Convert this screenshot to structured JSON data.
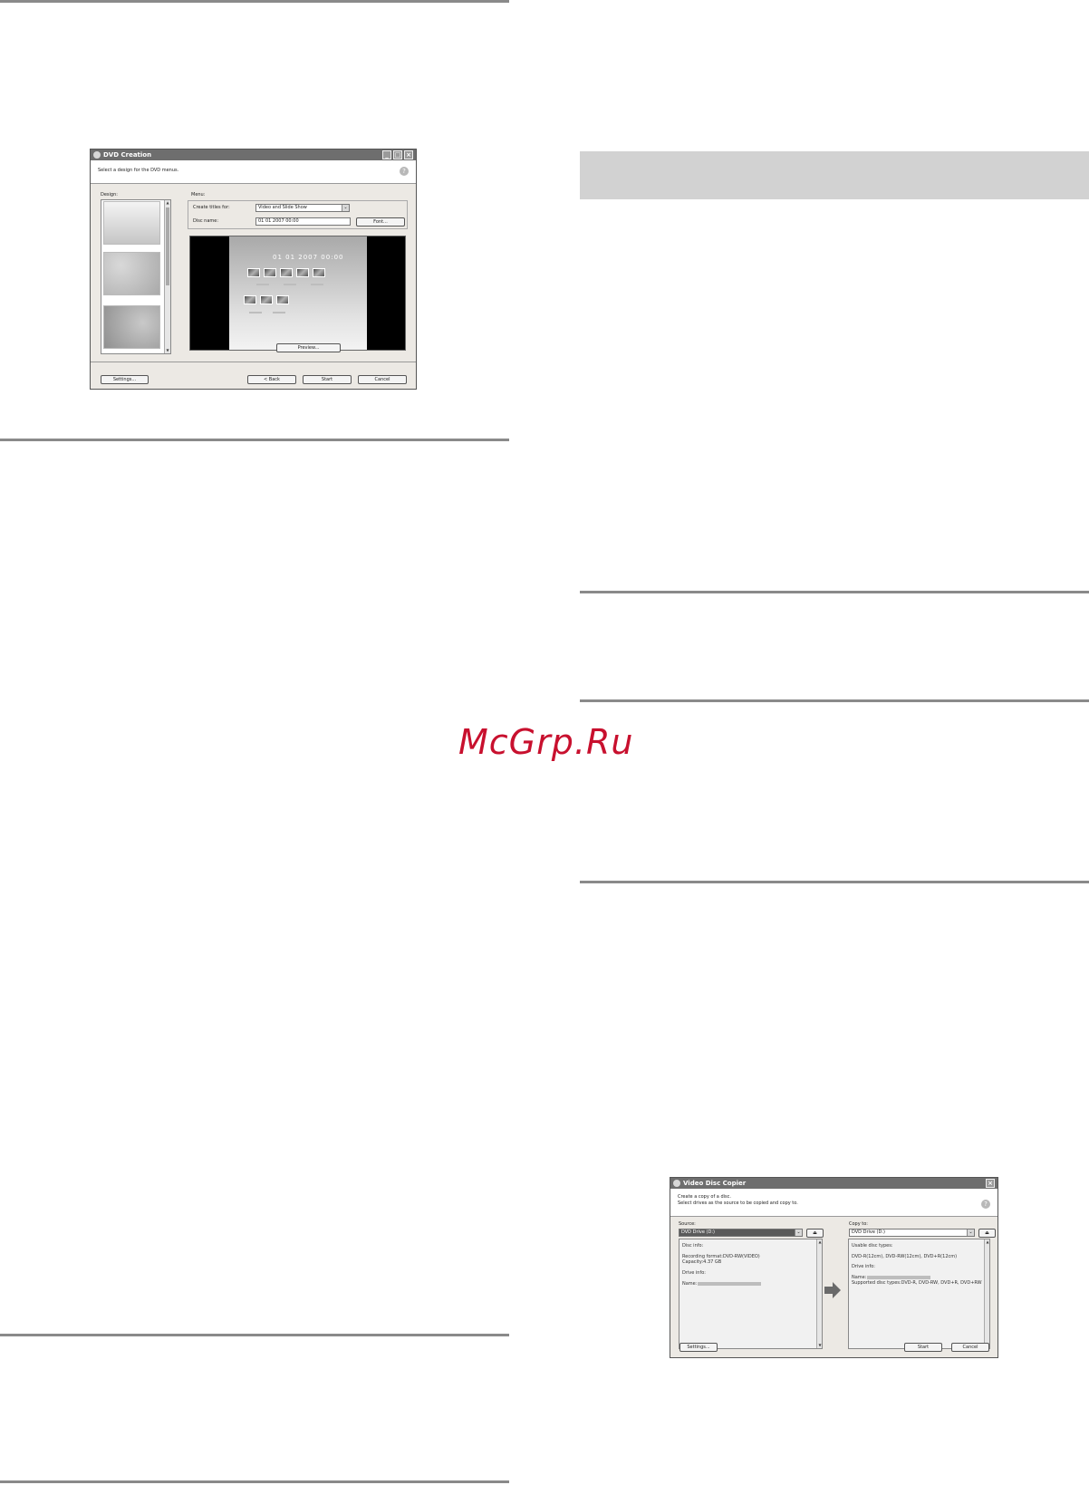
{
  "dvd_creation": {
    "title": "DVD Creation",
    "instruction": "Select a design for the DVD menus.",
    "design_label": "Design:",
    "menu_label": "Menu:",
    "create_titles_label": "Create titles for:",
    "create_titles_value": "Video and Slide Show",
    "disc_name_label": "Disc name:",
    "disc_name_value": "01 01 2007  00:00",
    "font_button": "Font...",
    "preview_title": "01 01 2007  00:00",
    "preview_button": "Preview...",
    "settings_button": "Settings...",
    "back_button": "< Back",
    "start_button": "Start",
    "cancel_button": "Cancel"
  },
  "video_disc_copier": {
    "title": "Video Disc Copier",
    "instruction_1": "Create a copy of a disc.",
    "instruction_2": "Select drives as the source to be copied and copy to.",
    "source_label": "Source:",
    "source_value": "DVD Drive (D:)",
    "copy_to_label": "Copy to:",
    "copy_to_value": "DVD Drive (D:)",
    "source_info": {
      "disc_info_label": "Disc info:",
      "recording_format": "Recording format:DVD-RW(VIDEO)",
      "capacity": "Capacity:4.37 GB",
      "drive_info_label": "Drive info:",
      "name_label": "Name:"
    },
    "target_info": {
      "usable_label": "Usable disc types:",
      "usable_types": "DVD-R(12cm), DVD-RW(12cm), DVD+R(12cm)",
      "drive_info_label": "Drive info:",
      "name_label": "Name:",
      "supported_types": "Supported disc types:DVD-R, DVD-RW, DVD+R, DVD+RW"
    },
    "settings_button": "Settings...",
    "start_button": "Start",
    "cancel_button": "Cancel"
  },
  "watermark": "McGrp.Ru",
  "colors": {
    "watermark": "#c8102e",
    "rule": "#8a8a8a",
    "band": "#d2d2d2"
  }
}
